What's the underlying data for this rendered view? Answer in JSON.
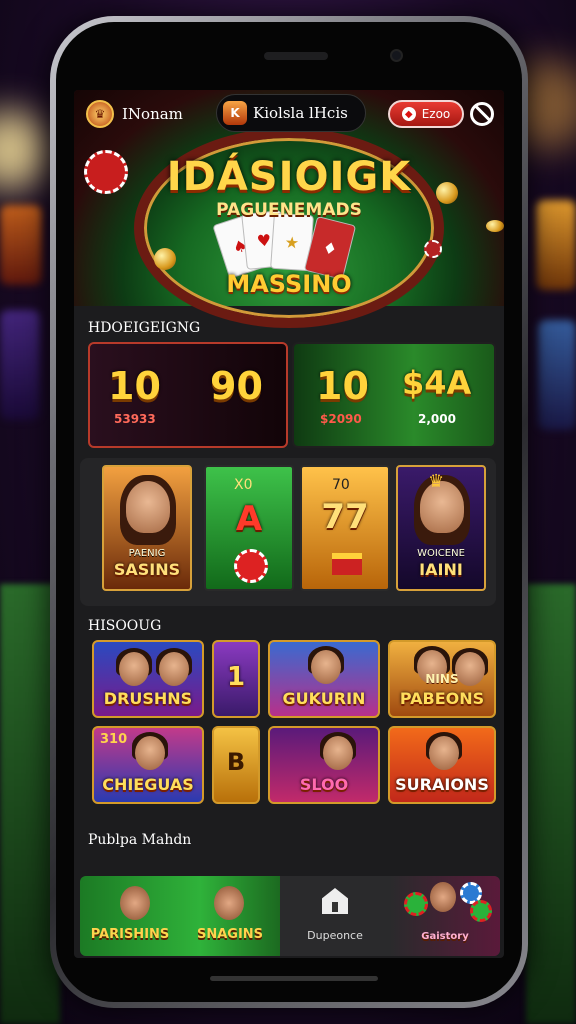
{
  "app": {
    "brand_name": "INonam",
    "search_pill_text": "Kiolsla lHcis",
    "action_button": "Ezoo"
  },
  "hero": {
    "title": "IDÁSIOIGK",
    "subtitle": "PAGUENEMADS",
    "name": "MASSINO"
  },
  "sections": {
    "promos_title": "HDOEIGEIGNG",
    "games_title": "HISOOUG",
    "bottom_title": "Publpa Mahdn"
  },
  "promos": [
    {
      "big_left": "10",
      "big_right": "90",
      "small": "53933"
    },
    {
      "big_left": "10",
      "big_right": "$4A",
      "small_left": "$2090",
      "small_right": "2,000"
    }
  ],
  "featured_games": [
    {
      "top": "",
      "label": "SASINS",
      "sub": "PAENIG"
    },
    {
      "top": "X0",
      "label": "A",
      "sub": ""
    },
    {
      "top": "70",
      "label": "77",
      "sub": ""
    },
    {
      "top": "",
      "label": "IAINI",
      "sub": "WOICENE"
    }
  ],
  "game_tiles": [
    {
      "label": "DRUSHNS"
    },
    {
      "label": "1"
    },
    {
      "label": "GUKURIN"
    },
    {
      "label": "PABEONS",
      "top": "NINS"
    },
    {
      "label": "CHIEGUAS",
      "top": "310"
    },
    {
      "label": "B"
    },
    {
      "label": "SLOO"
    },
    {
      "label": "SURAIONS"
    }
  ],
  "bottom_tabs": [
    {
      "label": "PARISHINS"
    },
    {
      "label": "SNAGINS"
    },
    {
      "label": "Dupeonce"
    },
    {
      "label": "Gaistory"
    }
  ],
  "colors": {
    "accent_gold": "#ffd33b",
    "felt_green": "#1e8a2c",
    "danger_red": "#d91f1a"
  }
}
